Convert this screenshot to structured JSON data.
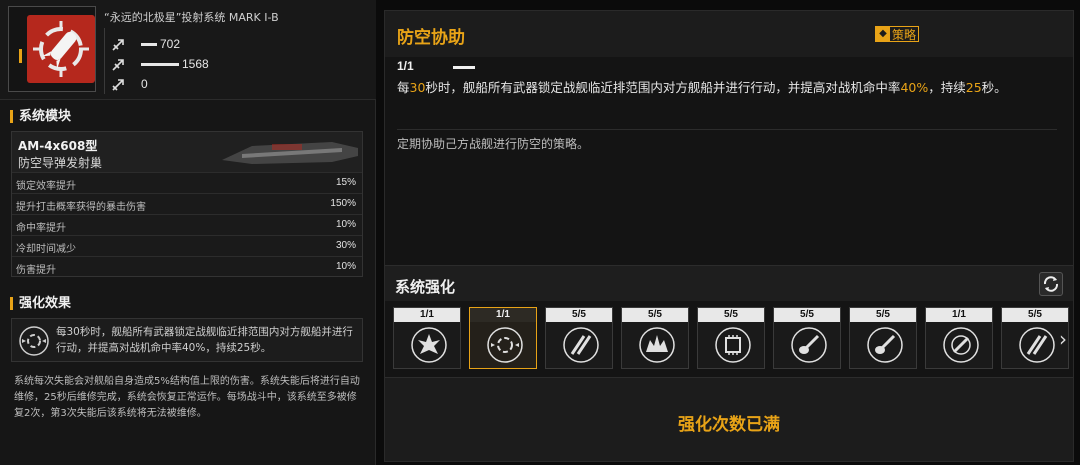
{
  "weapon": {
    "system_name": "“永远的北极星”投射系统 MARK I-B",
    "icon": "missile-target-icon",
    "stats": [
      {
        "icon": "damage-stat-icon",
        "value": "702"
      },
      {
        "icon": "range-stat-icon",
        "value": "1568"
      },
      {
        "icon": "speed-stat-icon",
        "value": "0"
      }
    ]
  },
  "module": {
    "section_title": "系统模块",
    "name": "AM-4x608型",
    "subtitle": "防空导弹发射巢",
    "rows": [
      {
        "label": "锁定效率提升",
        "value": "15%"
      },
      {
        "label": "提升打击概率获得的暴击伤害",
        "value": "150%"
      },
      {
        "label": "命中率提升",
        "value": "10%"
      },
      {
        "label": "冷却时间减少",
        "value": "30%"
      },
      {
        "label": "伤害提升",
        "value": "10%"
      }
    ]
  },
  "effect": {
    "section_title": "强化效果",
    "text": "每30秒时，舰船所有武器锁定战舰临近排范围内对方舰船并进行行动，并提高对战机命中率40%，持续25秒。",
    "note": "系统每次失能会对舰船自身造成5%结构值上限的伤害。系统失能后将进行自动维修，25秒后维修完成，系统会恢复正常运作。每场战斗中，该系统至多被修复2次，第3次失能后该系统将无法被维修。"
  },
  "skill": {
    "title": "防空协助",
    "strategy_label": "策略",
    "level": "1/1",
    "desc": {
      "p1": "每",
      "v1": "30",
      "p2": "秒时，舰船所有武器锁定战舰临近排范围内对方舰船并进行行动，并提高对战机命中率",
      "v2": "40%",
      "p3": "，持续",
      "v3": "25",
      "p4": "秒。"
    },
    "note": "定期协助己方战舰进行防空的策略。"
  },
  "enhance": {
    "title": "系统强化",
    "slots": [
      {
        "count": "1/1",
        "icon": "burst-icon",
        "selected": false
      },
      {
        "count": "1/1",
        "icon": "target-assist-icon",
        "selected": true
      },
      {
        "count": "5/5",
        "icon": "missile-pair-icon",
        "selected": false
      },
      {
        "count": "5/5",
        "icon": "explosion-icon",
        "selected": false
      },
      {
        "count": "5/5",
        "icon": "chip-icon",
        "selected": false
      },
      {
        "count": "5/5",
        "icon": "guitar-missile-icon",
        "selected": false
      },
      {
        "count": "5/5",
        "icon": "guitar-missile-icon",
        "selected": false
      },
      {
        "count": "1/1",
        "icon": "crosshair-rocket-icon",
        "selected": false
      },
      {
        "count": "5/5",
        "icon": "missile-pair-icon",
        "selected": false
      }
    ],
    "maxed_text": "强化次数已满"
  },
  "colors": {
    "accent": "#e8a317",
    "weapon_bg": "#b5281d"
  }
}
